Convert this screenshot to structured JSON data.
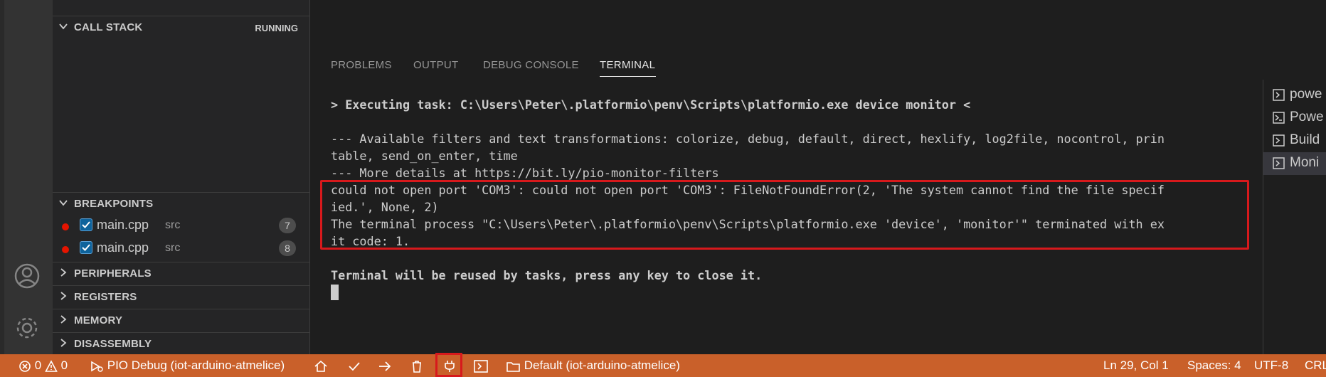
{
  "sidebar": {
    "call_stack": {
      "title": "CALL STACK",
      "state": "RUNNING"
    },
    "breakpoints": {
      "title": "BREAKPOINTS",
      "items": [
        {
          "file": "main.cpp",
          "dir": "src",
          "line": "7"
        },
        {
          "file": "main.cpp",
          "dir": "src",
          "line": "8"
        }
      ]
    },
    "sections": [
      "PERIPHERALS",
      "REGISTERS",
      "MEMORY",
      "DISASSEMBLY"
    ]
  },
  "panel": {
    "tabs": [
      "PROBLEMS",
      "OUTPUT",
      "DEBUG CONSOLE",
      "TERMINAL"
    ],
    "active_tab": "TERMINAL",
    "terminal_lines": [
      "> Executing task: C:\\Users\\Peter\\.platformio\\penv\\Scripts\\platformio.exe device monitor <",
      "--- Available filters and text transformations: colorize, debug, default, direct, hexlify, log2file, nocontrol, prin",
      "table, send_on_enter, time",
      "--- More details at https://bit.ly/pio-monitor-filters",
      "could not open port 'COM3': could not open port 'COM3': FileNotFoundError(2, 'The system cannot find the file specif",
      "ied.', None, 2)",
      "The terminal process \"C:\\Users\\Peter\\.platformio\\penv\\Scripts\\platformio.exe 'device', 'monitor'\" terminated with ex",
      "it code: 1.",
      "Terminal will be reused by tasks, press any key to close it."
    ],
    "terminal_list": [
      "powe",
      "Powe",
      "Build",
      "Moni"
    ]
  },
  "status_bar": {
    "errors": "0",
    "warnings": "0",
    "debug_config": "PIO Debug (iot-arduino-atmelice)",
    "env": "Default (iot-arduino-atmelice)",
    "position": "Ln 29, Col 1",
    "spaces": "Spaces: 4",
    "encoding": "UTF-8",
    "eol": "CRL"
  },
  "colors": {
    "status_bar": "#c9602a",
    "highlight_box": "#d7191c",
    "breakpoint": "#e51400"
  }
}
